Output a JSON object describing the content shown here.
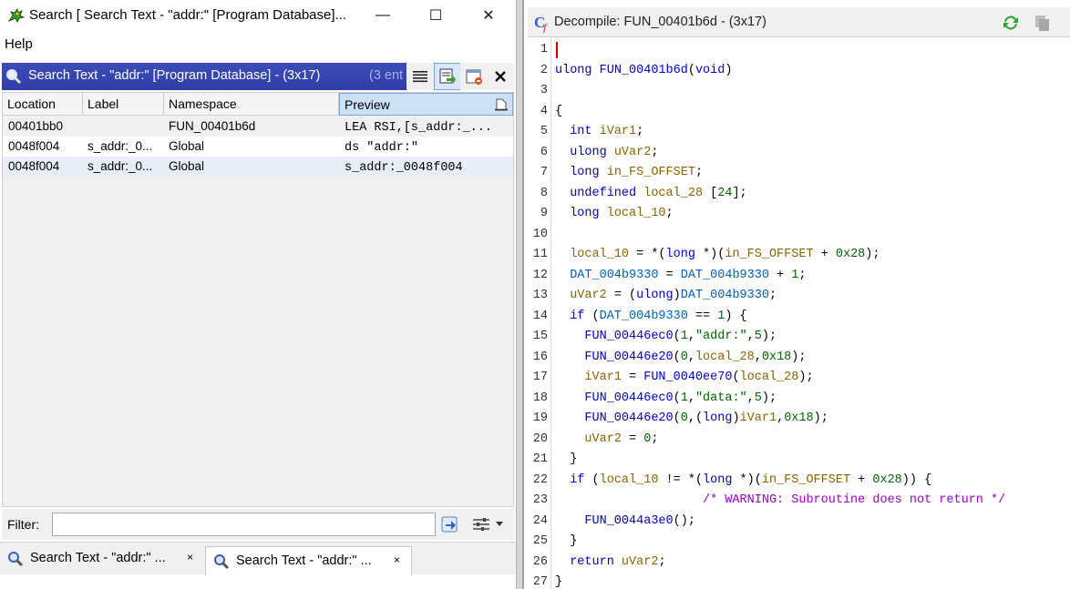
{
  "search_window": {
    "title": "Search [ Search Text - \"addr:\"  [Program Database]...",
    "menu": [
      "Help"
    ],
    "component": {
      "title": "Search Text - \"addr:\"  [Program Database]  - (3x17)",
      "count_fragment": "(3 ent",
      "columns": [
        "Location",
        "Label",
        "Namespace",
        "Preview"
      ],
      "rows": [
        {
          "location": "00401bb0",
          "label": "",
          "namespace": "FUN_00401b6d",
          "preview": "LEA RSI,[s_addr:_..."
        },
        {
          "location": "0048f004",
          "label": "s_addr:_0...",
          "namespace": "Global",
          "preview": "ds \"addr:\""
        },
        {
          "location": "0048f004",
          "label": "s_addr:_0...",
          "namespace": "Global",
          "preview": "s_addr:_0048f004"
        }
      ]
    },
    "filter": {
      "label": "Filter:",
      "value": ""
    },
    "tabs": [
      {
        "label": "Search Text - \"addr:\" ...",
        "close": "×"
      },
      {
        "label": "Search Text - \"addr:\" ...",
        "close": "×"
      }
    ],
    "window_controls": {
      "minimize": "—",
      "maximize": "☐",
      "close": "✕"
    }
  },
  "decompile_window": {
    "title": "Decompile: FUN_00401b6d - (3x17)",
    "line_numbers": [
      "1",
      "2",
      "3",
      "4",
      "5",
      "6",
      "7",
      "8",
      "9",
      "10",
      "11",
      "12",
      "13",
      "14",
      "15",
      "16",
      "17",
      "18",
      "19",
      "20",
      "21",
      "22",
      "23",
      "24",
      "25",
      "26",
      "27"
    ],
    "code_lines": [
      "",
      "ulong FUN_00401b6d(void)",
      "",
      "{",
      "  int iVar1;",
      "  ulong uVar2;",
      "  long in_FS_OFFSET;",
      "  undefined local_28 [24];",
      "  long local_10;",
      "",
      "  local_10 = *(long *)(in_FS_OFFSET + 0x28);",
      "  DAT_004b9330 = DAT_004b9330 + 1;",
      "  uVar2 = (ulong)DAT_004b9330;",
      "  if (DAT_004b9330 == 1) {",
      "    FUN_00446ec0(1,\"addr:\",5);",
      "    FUN_00446e20(0,local_28,0x18);",
      "    iVar1 = FUN_0040ee70(local_28);",
      "    FUN_00446ec0(1,\"data:\",5);",
      "    FUN_00446e20(0,(long)iVar1,0x18);",
      "    uVar2 = 0;",
      "  }",
      "  if (local_10 != *(long *)(in_FS_OFFSET + 0x28)) {",
      "                    /* WARNING: Subroutine does not return */",
      "    FUN_0044a3e0();",
      "  }",
      "  return uVar2;",
      "}"
    ]
  },
  "colors": {
    "header_blue": "#2f3ea6",
    "keyword": "#0000c8",
    "variable": "#8a6400",
    "number": "#006400",
    "comment": "#9900cc",
    "cursor": "#d00000"
  }
}
